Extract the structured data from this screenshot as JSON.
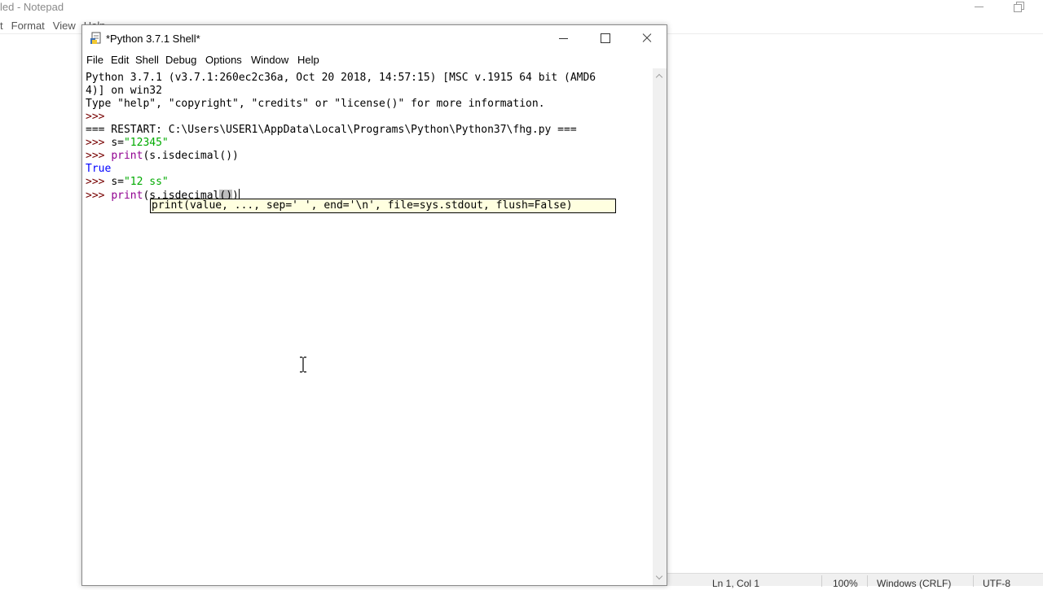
{
  "notepad": {
    "title": "led - Notepad",
    "menu": [
      "t",
      "Format",
      "View",
      "Help"
    ],
    "status": {
      "position": "Ln 1, Col 1",
      "zoom": "100%",
      "line_ending": "Windows (CRLF)",
      "encoding": "UTF-8"
    }
  },
  "shell": {
    "title": "*Python 3.7.1 Shell*",
    "menu": [
      "File",
      "Edit",
      "Shell",
      "Debug",
      "Options",
      "Window",
      "Help"
    ],
    "lines": {
      "banner1": "Python 3.7.1 (v3.7.1:260ec2c36a, Oct 20 2018, 14:57:15) [MSC v.1915 64 bit (AMD6",
      "banner2": "4)] on win32",
      "banner3": "Type \"help\", \"copyright\", \"credits\" or \"license()\" for more information.",
      "prompt": ">>> ",
      "restart": "=== RESTART: C:\\Users\\USER1\\AppData\\Local\\Programs\\Python\\Python37\\fhg.py ===",
      "assign1_code": "s=",
      "assign1_str": "\"12345\"",
      "print_fn": "print",
      "print_args": "(s.isdecimal())",
      "output1": "True",
      "assign2_code": "s=",
      "assign2_str": "\"12 ss\"",
      "print2_args_start": "(s.isdecimal",
      "print2_args_hl": "()",
      "print2_args_end": ")"
    },
    "calltip": "print(value, ..., sep=' ', end='\\n', file=sys.stdout, flush=False)"
  }
}
